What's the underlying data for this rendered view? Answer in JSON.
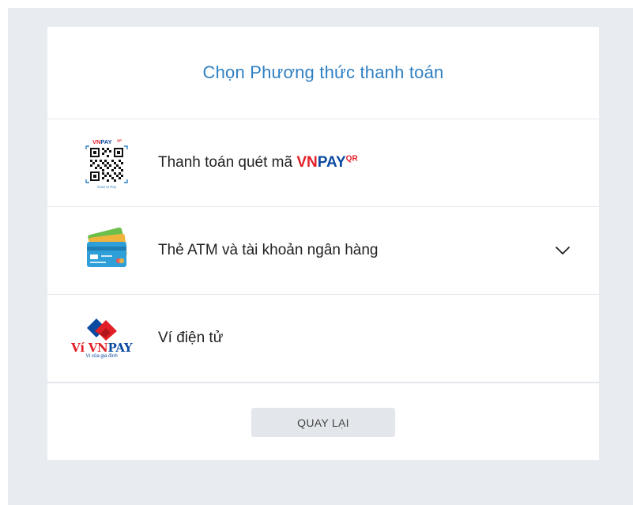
{
  "page": {
    "title": "Chọn Phương thức thanh toán"
  },
  "methods": [
    {
      "label_prefix": "Thanh toán quét mã ",
      "brand_vn": "VN",
      "brand_pay": "PAY",
      "brand_sup": "QR",
      "logo": {
        "top_text": "VNPAY",
        "top_sup": "QR",
        "bottom_text": "Scan to Pay",
        "icon": "qr-code-icon"
      }
    },
    {
      "label": "Thẻ ATM và tài khoản ngân hàng",
      "logo": {
        "icon": "bank-cards-icon"
      },
      "expand_icon": "chevron-down-icon"
    },
    {
      "label": "Ví điện tử",
      "logo": {
        "text_vi": "Ví",
        "text_vn": "VN",
        "text_pay": "PAY",
        "tagline": "Ví của gia đình",
        "icon": "vnpay-wallet-logo"
      }
    }
  ],
  "footer": {
    "back_label": "QUAY LẠI"
  },
  "colors": {
    "title": "#2f80c2",
    "brand_red": "#e21f27",
    "brand_blue": "#0a4aa1",
    "backdrop": "#e8ebef",
    "button_bg": "#e3e7ec"
  }
}
